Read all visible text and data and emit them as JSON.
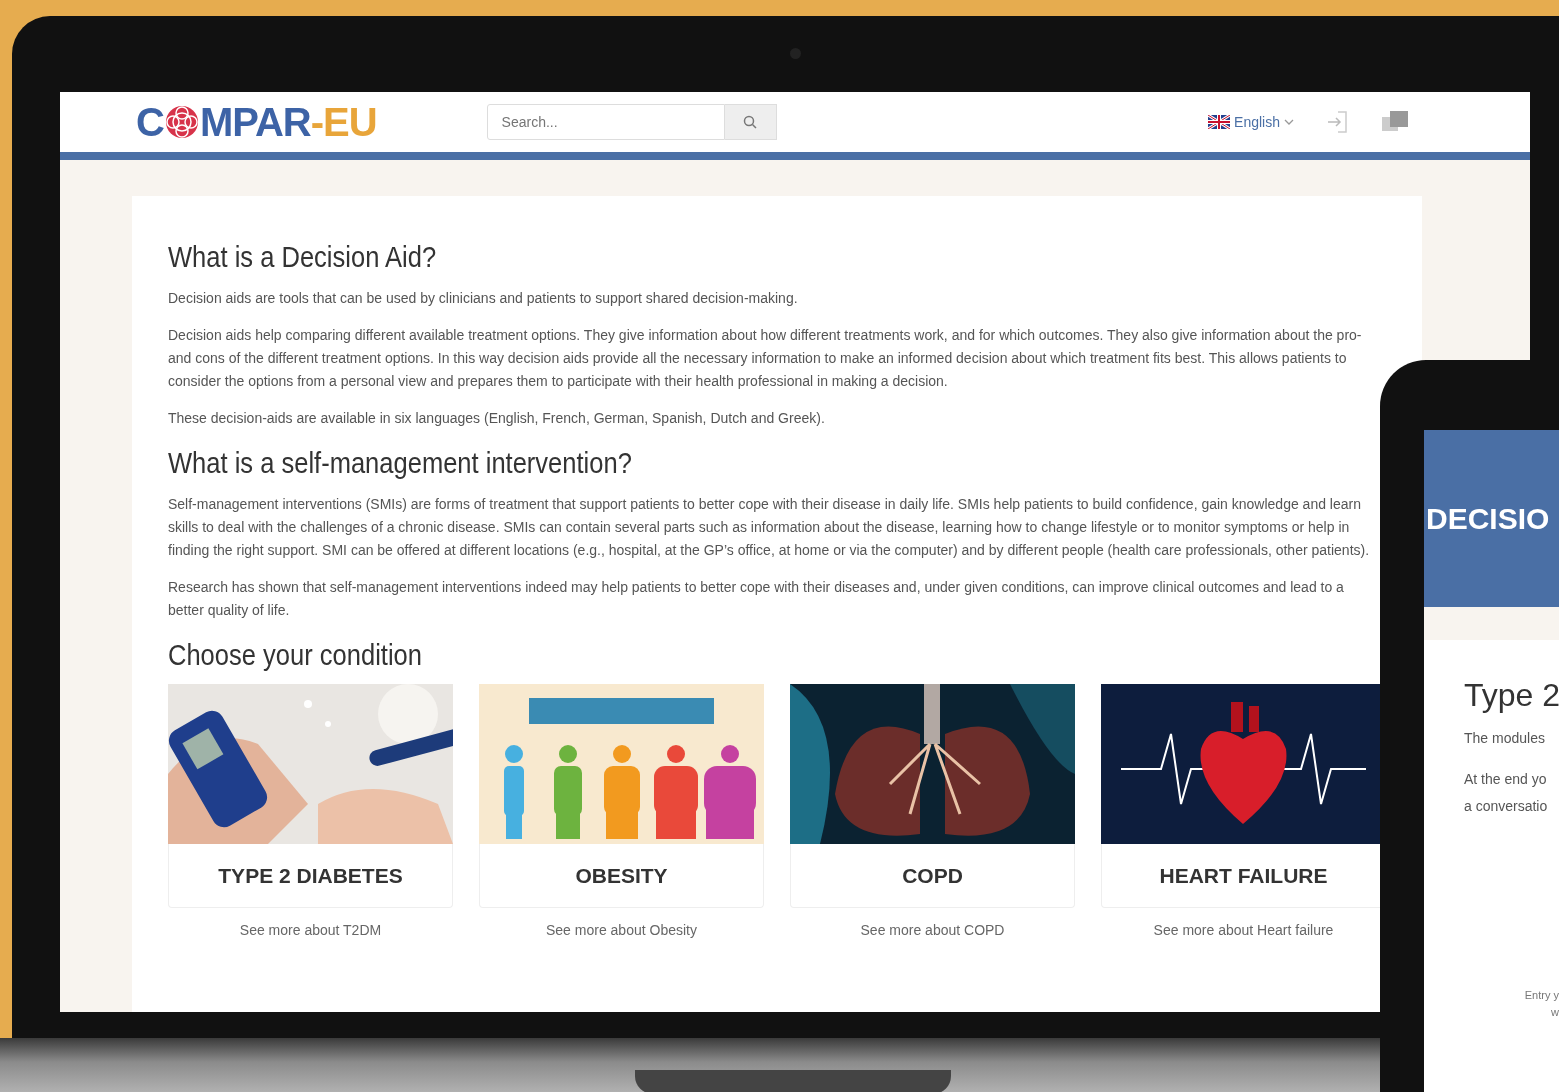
{
  "laptop": {
    "header": {
      "logo": {
        "first": "C",
        "rest": "MPAR",
        "suffix": "-EU"
      },
      "search": {
        "placeholder": "Search..."
      },
      "language": "English"
    },
    "sections": [
      {
        "title": "What is a Decision Aid?",
        "paragraphs": [
          "Decision aids are tools that can be used by clinicians and patients to support shared decision-making.",
          "Decision aids help comparing different available treatment options. They give information about how different treatments work, and for which outcomes. They also give information about the pro- and cons of the different treatment options. In this way decision aids provide all the necessary information to make an informed decision about which treatment fits best. This allows patients to consider the options from a personal view and prepares them to participate with their health professional in making a decision.",
          "These decision-aids are available in six languages (English, French, German, Spanish, Dutch and Greek)."
        ]
      },
      {
        "title": "What is a self-management intervention?",
        "paragraphs": [
          "Self-management interventions (SMIs) are forms of treatment that support patients to better cope with their disease in daily life. SMIs help patients to build confidence, gain knowledge and learn skills to deal with the challenges of a chronic disease. SMIs can contain several parts such as information about the disease, learning how to change lifestyle or to monitor symptoms or help in finding the right support. SMI can be offered at different locations (e.g., hospital, at the GP’s office, at home or via the computer) and by different people (health care professionals, other patients).",
          "Research has shown that self-management interventions indeed may help patients to better cope with their diseases and, under given conditions, can improve clinical outcomes and lead to a better quality of life."
        ]
      }
    ],
    "conditions_title": "Choose your condition",
    "conditions": [
      {
        "kind": "diabetes",
        "name": "TYPE 2 DIABETES",
        "link": "See more about T2DM"
      },
      {
        "kind": "obesity",
        "name": "OBESITY",
        "link": "See more about Obesity"
      },
      {
        "kind": "lungs",
        "name": "COPD",
        "link": "See more about COPD"
      },
      {
        "kind": "heart",
        "name": "HEART FAILURE",
        "link": "See more about Heart failure"
      }
    ]
  },
  "tablet": {
    "banner": "DECISIO",
    "title": "Type 2",
    "lines": [
      "The modules",
      "At the end yo",
      "a conversatio"
    ],
    "footer": [
      "Entry y",
      "w"
    ]
  }
}
